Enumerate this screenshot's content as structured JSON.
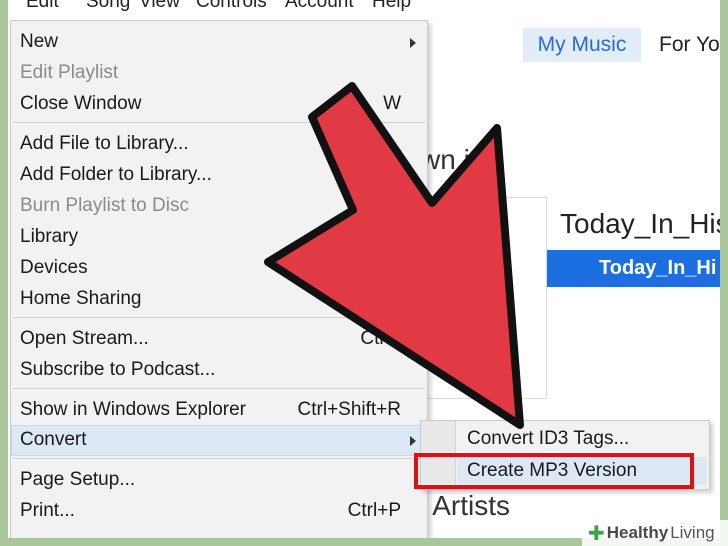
{
  "menubar": {
    "items": [
      "Edit",
      "Song",
      "View",
      "Controls",
      "Account",
      "Help"
    ]
  },
  "header": {
    "tab_my_music": "My Music",
    "tab_for_you": "For Yo"
  },
  "content": {
    "heading_playlist": "wn  ist",
    "today_title": "Today_In_His",
    "today_button": "Today_In_Hi",
    "heading_artists": "s Artists"
  },
  "file_menu": {
    "new": "New",
    "edit_playlist": "Edit Playlist",
    "close_window": "Close Window",
    "close_window_shortcut": "W",
    "add_file": "Add File to Library...",
    "add_folder": "Add Folder to Library...",
    "burn_playlist": "Burn Playlist to Disc",
    "library": "Library",
    "devices": "Devices",
    "home_sharing": "Home Sharing",
    "open_stream": "Open Stream...",
    "open_stream_shortcut": "Ctrl+",
    "subscribe_podcast": "Subscribe to Podcast...",
    "show_explorer": "Show in Windows Explorer",
    "show_explorer_shortcut": "Ctrl+Shift+R",
    "convert": "Convert",
    "page_setup": "Page Setup...",
    "print": "Print...",
    "print_shortcut": "Ctrl+P"
  },
  "convert_submenu": {
    "convert_id3": "Convert ID3 Tags...",
    "create_mp3": "Create MP3 Version"
  },
  "colors": {
    "accent_blue": "#1c6fe0",
    "highlight_red": "#e01010",
    "arrow_red": "#e23a45",
    "frame_green": "#a9c79b"
  },
  "watermark": {
    "brand": "Healthy",
    "brand_suffix": "Living"
  }
}
